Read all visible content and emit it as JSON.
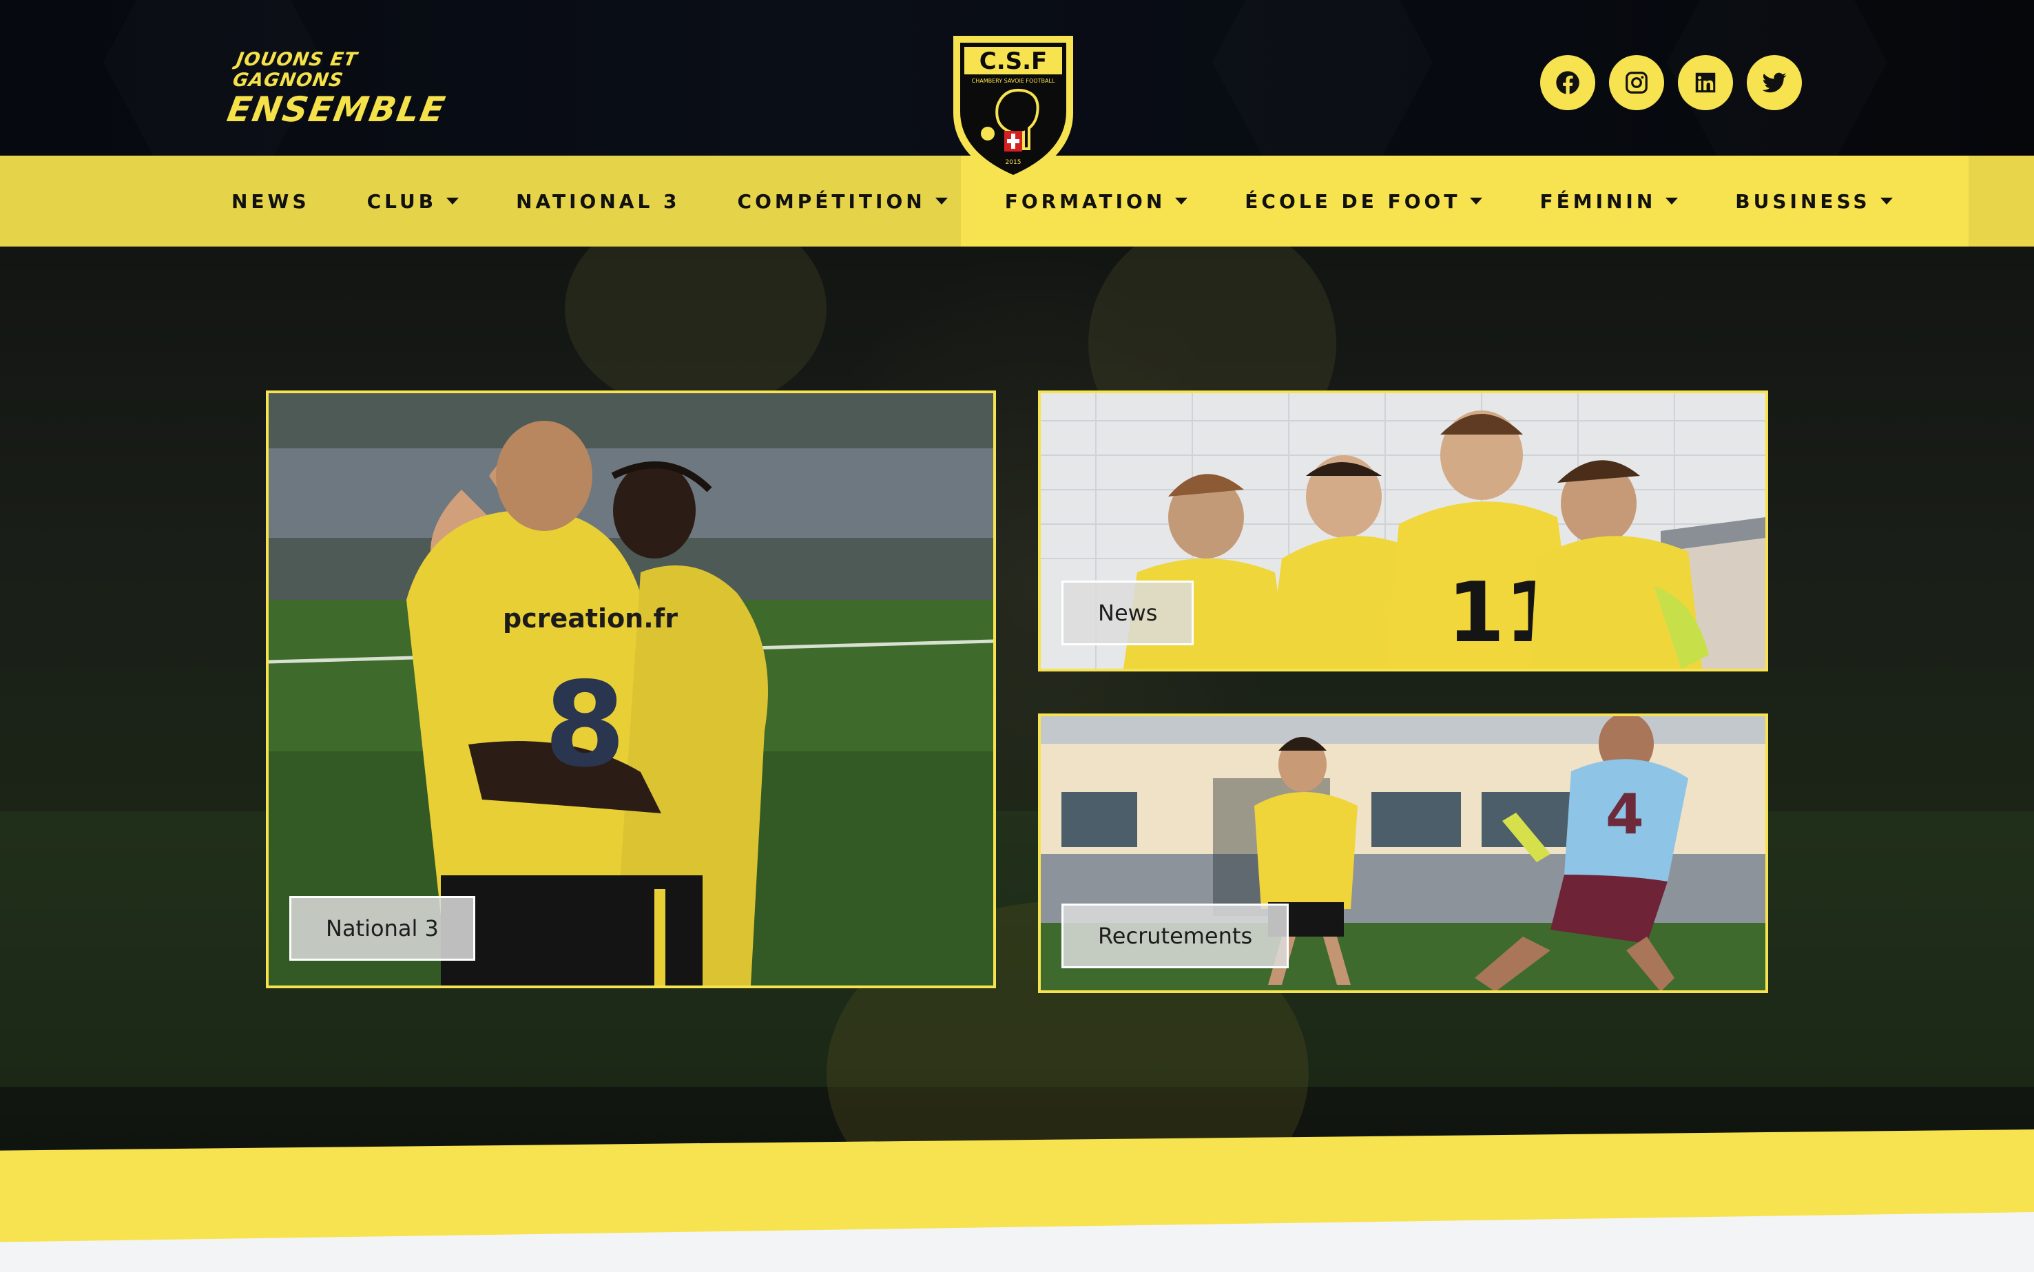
{
  "header": {
    "tagline_small": "JOUONS ET GAGNONS",
    "tagline_big": "ENSEMBLE",
    "crest_title": "C.S.F",
    "crest_subtitle": "CHAMBERY SAVOIE FOOTBALL",
    "crest_year": "2015"
  },
  "social": [
    {
      "name": "facebook-icon"
    },
    {
      "name": "instagram-icon"
    },
    {
      "name": "linkedin-icon"
    },
    {
      "name": "twitter-icon"
    }
  ],
  "nav": [
    {
      "label": "NEWS",
      "dropdown": false
    },
    {
      "label": "CLUB",
      "dropdown": true
    },
    {
      "label": "NATIONAL 3",
      "dropdown": false
    },
    {
      "label": "COMPÉTITION",
      "dropdown": true
    },
    {
      "label": "FORMATION",
      "dropdown": true
    },
    {
      "label": "ÉCOLE DE FOOT",
      "dropdown": true
    },
    {
      "label": "FÉMININ",
      "dropdown": true
    },
    {
      "label": "BUSINESS",
      "dropdown": true
    }
  ],
  "cards": {
    "national": {
      "label": "National 3",
      "jersey_text": "pcreation.fr",
      "jersey_number": "8"
    },
    "news": {
      "label": "News",
      "jersey_number": "11"
    },
    "recrutements": {
      "label": "Recrutements",
      "jersey_number": "4"
    }
  },
  "colors": {
    "accent": "#f7e34f",
    "dark": "#070a10"
  }
}
